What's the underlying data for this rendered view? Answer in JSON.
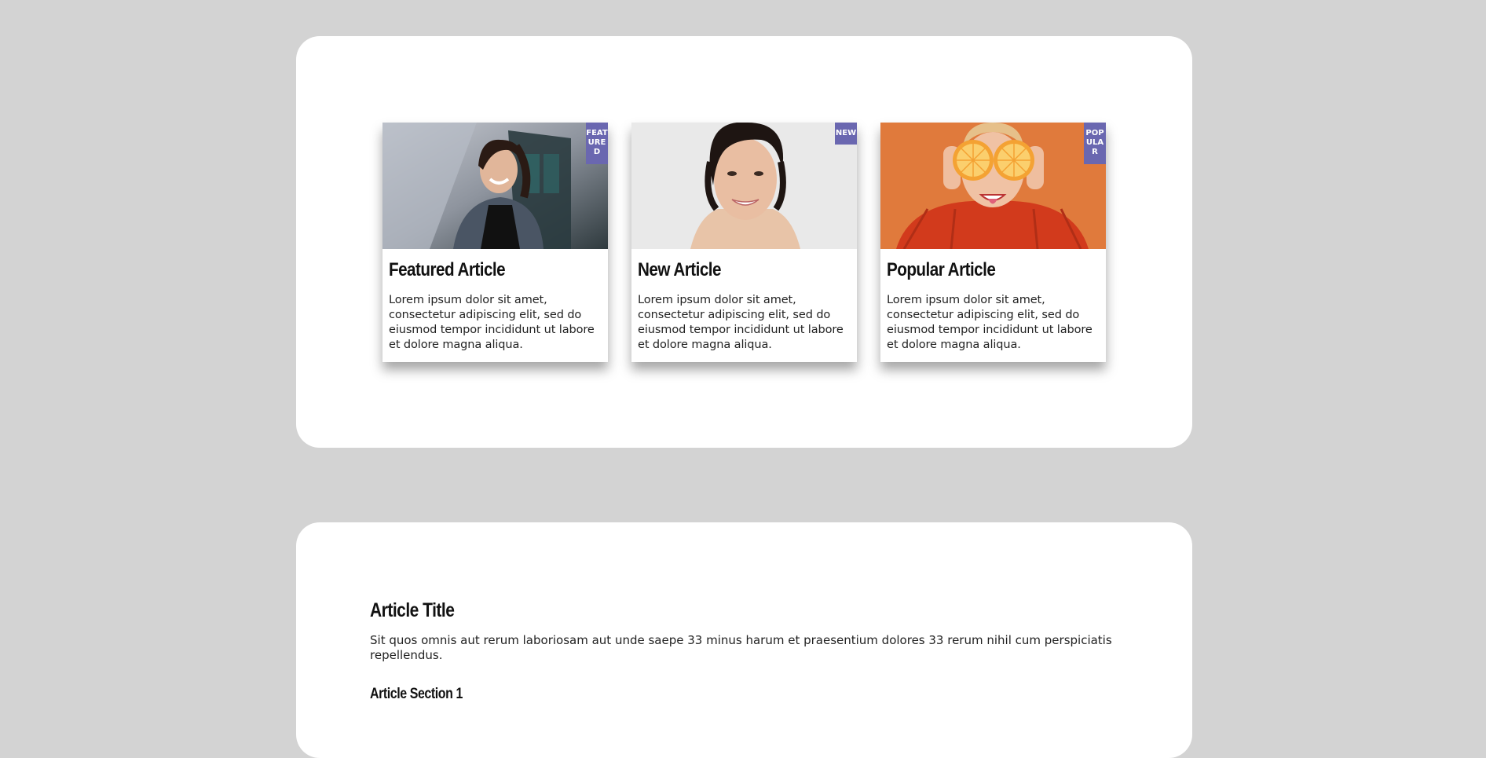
{
  "cards": [
    {
      "badge": "FEATURED",
      "title": "Featured Article",
      "text": "Lorem ipsum dolor sit amet, consectetur adipiscing elit, sed do eiusmod tempor incididunt ut labore et dolore magna aliqua."
    },
    {
      "badge": "NEW",
      "title": "New Article",
      "text": "Lorem ipsum dolor sit amet, consectetur adipiscing elit, sed do eiusmod tempor incididunt ut labore et dolore magna aliqua."
    },
    {
      "badge": "POPULAR",
      "title": "Popular Article",
      "text": "Lorem ipsum dolor sit amet, consectetur adipiscing elit, sed do eiusmod tempor incididunt ut labore et dolore magna aliqua."
    }
  ],
  "article": {
    "title": "Article Title",
    "intro": "Sit quos omnis aut rerum laboriosam aut unde saepe 33 minus harum et praesentium dolores 33 rerum nihil cum perspiciatis repellendus.",
    "section_1_title": "Article Section 1"
  },
  "colors": {
    "page_background": "#d3d3d3",
    "panel_background": "#ffffff",
    "badge_background": "#6a67b0"
  }
}
